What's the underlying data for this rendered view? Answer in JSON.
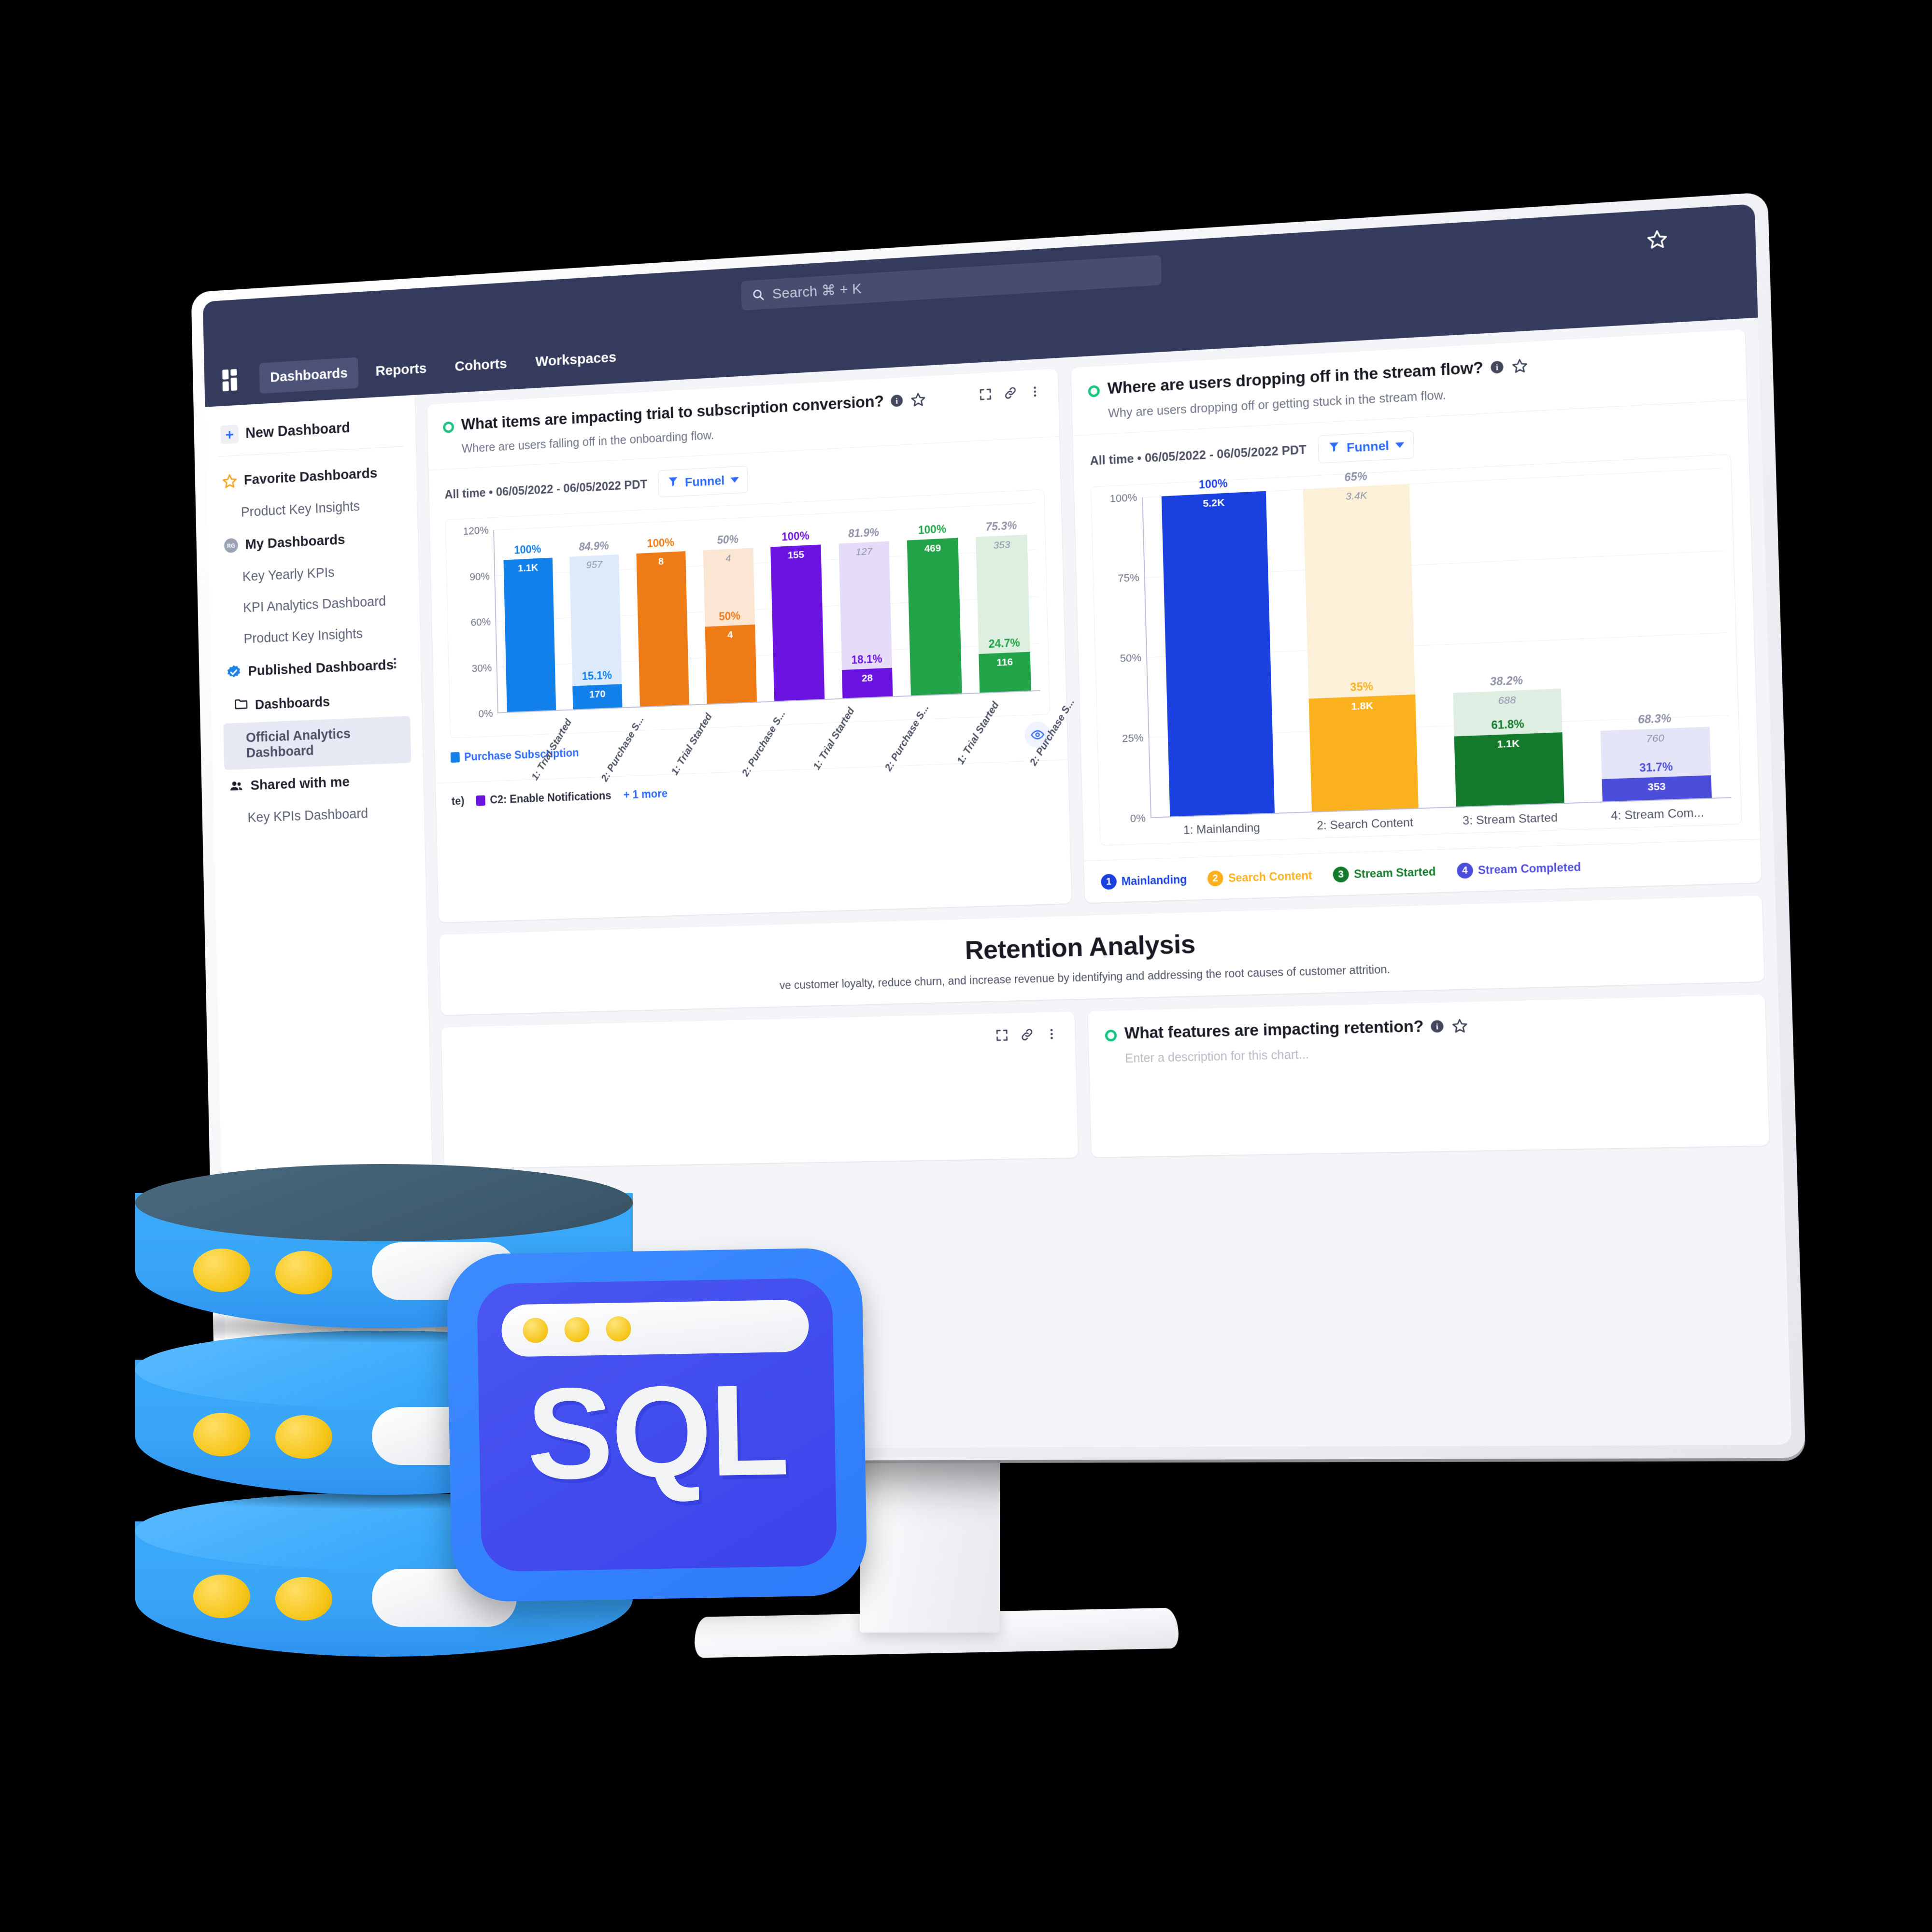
{
  "topbar": {
    "search_placeholder": "Search ⌘ + K",
    "search_value": "",
    "star_icon": "star-icon",
    "search_icon": "search-icon"
  },
  "nav": {
    "logo_icon": "app-grid-logo",
    "items": [
      {
        "label": "Dashboards",
        "active": true
      },
      {
        "label": "Reports",
        "active": false
      },
      {
        "label": "Cohorts",
        "active": false
      },
      {
        "label": "Workspaces",
        "active": false
      }
    ]
  },
  "sidebar": {
    "new_dashboard": "New Dashboard",
    "groups": [
      {
        "label": "Favorite Dashboards",
        "icon": "star-icon",
        "kebab": false
      },
      {
        "label": "My Dashboards",
        "icon": "avatar-rg",
        "kebab": false
      },
      {
        "label": "Published Dashboards",
        "icon": "verified-badge-icon",
        "kebab": true
      },
      {
        "label": "Shared with me",
        "icon": "people-icon",
        "kebab": false
      }
    ],
    "favorites": [
      "Product Key Insights"
    ],
    "mine": [
      "Key Yearly KPIs",
      "KPI Analytics Dashboard",
      "Product Key Insights"
    ],
    "published_folder": "Dashboards",
    "published_items": [
      {
        "label": "Official Analytics Dashboard",
        "selected": true
      }
    ],
    "shared": [
      "Key KPIs Dashboard"
    ]
  },
  "card1": {
    "title": "What items are impacting trial to subscription conversion?",
    "subtitle": "Where are users falling off in the onboarding flow.",
    "meta": "All time • 06/05/2022 - 06/05/2022 PDT",
    "funnel_label": "Funnel",
    "legend_top": "Purchase Subscription",
    "legend_partial": "te)",
    "legend_c2": "C2: Enable Notifications",
    "legend_more": "+ 1 more",
    "icons": [
      "info-icon",
      "star-icon",
      "expand-icon",
      "link-icon",
      "kebab-icon",
      "eye-icon"
    ]
  },
  "card2": {
    "title": "Where are users dropping off in the stream flow?",
    "subtitle": "Why are users dropping off or getting stuck in the stream flow.",
    "meta": "All time • 06/05/2022 - 06/05/2022 PDT",
    "funnel_label": "Funnel",
    "icons": [
      "info-icon",
      "star-icon"
    ]
  },
  "retention": {
    "title": "Retention Analysis",
    "subtitle": "ve customer loyalty, reduce churn, and increase revenue by identifying and addressing the root causes of customer attrition."
  },
  "card3": {
    "title": "What features are impacting retention?",
    "subtitle": "Enter a description for this chart...",
    "icons": [
      "info-icon",
      "star-icon",
      "expand-icon",
      "link-icon",
      "kebab-icon"
    ]
  },
  "sql_graphic": {
    "label": "SQL",
    "card_color": "#3b43ea",
    "frame_color": "#2e7bfb",
    "db_color": "#3aa9fb",
    "dot_color": "#f5c518"
  },
  "chart_data": [
    {
      "type": "bar",
      "title": "What items are impacting trial to subscription conversion?",
      "xlabel": "",
      "ylabel": "",
      "ylim": [
        0,
        120
      ],
      "yticks": [
        "0%",
        "30%",
        "60%",
        "90%",
        "120%"
      ],
      "grid": true,
      "legend_position": "bottom",
      "categories": [
        "1: Trial Started",
        "2: Purchase S...",
        "1: Trial Started",
        "2: Purchase S...",
        "1: Trial Started",
        "2: Purchase S...",
        "1: Trial Started",
        "2: Purchase S..."
      ],
      "bars": [
        {
          "pct": "100%",
          "count": "1.1K",
          "value": 100,
          "ghost_pct": null,
          "ghost_count": null,
          "ghost_value": null,
          "color": "#1180ea",
          "ghost_color": "#dceafb"
        },
        {
          "pct": "15.1%",
          "count": "170",
          "value": 15.1,
          "ghost_pct": "84.9%",
          "ghost_count": "957",
          "ghost_value": 100,
          "color": "#1180ea",
          "ghost_color": "#dceafb"
        },
        {
          "pct": "100%",
          "count": "8",
          "value": 100,
          "ghost_pct": null,
          "ghost_count": null,
          "ghost_value": null,
          "color": "#ef7b17",
          "ghost_color": "#fbe5d3"
        },
        {
          "pct": "50%",
          "count": "4",
          "value": 50,
          "ghost_pct": "50%",
          "ghost_count": "4",
          "ghost_value": 100,
          "color": "#ef7b17",
          "ghost_color": "#fbe5d3"
        },
        {
          "pct": "100%",
          "count": "155",
          "value": 100,
          "ghost_pct": null,
          "ghost_count": null,
          "ghost_value": null,
          "color": "#6a12e0",
          "ghost_color": "#e6dcfa"
        },
        {
          "pct": "18.1%",
          "count": "28",
          "value": 18.1,
          "ghost_pct": "81.9%",
          "ghost_count": "127",
          "ghost_value": 100,
          "color": "#6a12e0",
          "ghost_color": "#e6dcfa"
        },
        {
          "pct": "100%",
          "count": "469",
          "value": 100,
          "ghost_pct": null,
          "ghost_count": null,
          "ghost_value": null,
          "color": "#23a347",
          "ghost_color": "#dcefe1"
        },
        {
          "pct": "24.7%",
          "count": "116",
          "value": 24.7,
          "ghost_pct": "75.3%",
          "ghost_count": "353",
          "ghost_value": 100,
          "color": "#23a347",
          "ghost_color": "#dcefe1"
        }
      ],
      "legend": [
        {
          "label": "Purchase Subscription",
          "color": "#1180ea"
        },
        {
          "label": "te)",
          "color": "#ef7b17"
        },
        {
          "label": "C2: Enable Notifications",
          "color": "#6a12e0"
        },
        {
          "label": "+ 1 more",
          "color": "#2d6bff"
        }
      ]
    },
    {
      "type": "bar",
      "title": "Where are users dropping off in the stream flow?",
      "xlabel": "",
      "ylabel": "",
      "ylim": [
        0,
        100
      ],
      "yticks": [
        "0%",
        "25%",
        "50%",
        "75%",
        "100%"
      ],
      "grid": true,
      "legend_position": "bottom",
      "categories": [
        "1: Mainlanding",
        "2: Search Content",
        "3: Stream Started",
        "4: Stream Com..."
      ],
      "bars": [
        {
          "pct": "100%",
          "count": "5.2K",
          "value": 100,
          "ghost_pct": null,
          "ghost_count": null,
          "ghost_value": null,
          "color": "#1a41e0",
          "ghost_color": "#e3e8fb"
        },
        {
          "pct": "35%",
          "count": "1.8K",
          "value": 35,
          "ghost_pct": "65%",
          "ghost_count": "3.4K",
          "ghost_value": 100,
          "color": "#fbb01e",
          "ghost_color": "#fdf0d9"
        },
        {
          "pct": "61.8%",
          "count": "1.1K",
          "value": 21.6,
          "ghost_pct": "38.2%",
          "ghost_count": "688",
          "ghost_value": 35,
          "color": "#137a2c",
          "ghost_color": "#dfeee3"
        },
        {
          "pct": "31.7%",
          "count": "353",
          "value": 6.85,
          "ghost_pct": "68.3%",
          "ghost_count": "760",
          "ghost_value": 21.6,
          "color": "#4d4ddb",
          "ghost_color": "#e5e5f8"
        }
      ],
      "legend": [
        {
          "num": "1",
          "label": "Mainlanding",
          "color": "#1a41e0"
        },
        {
          "num": "2",
          "label": "Search Content",
          "color": "#fbb01e"
        },
        {
          "num": "3",
          "label": "Stream Started",
          "color": "#137a2c"
        },
        {
          "num": "4",
          "label": "Stream Completed",
          "color": "#4d4ddb"
        }
      ]
    }
  ]
}
